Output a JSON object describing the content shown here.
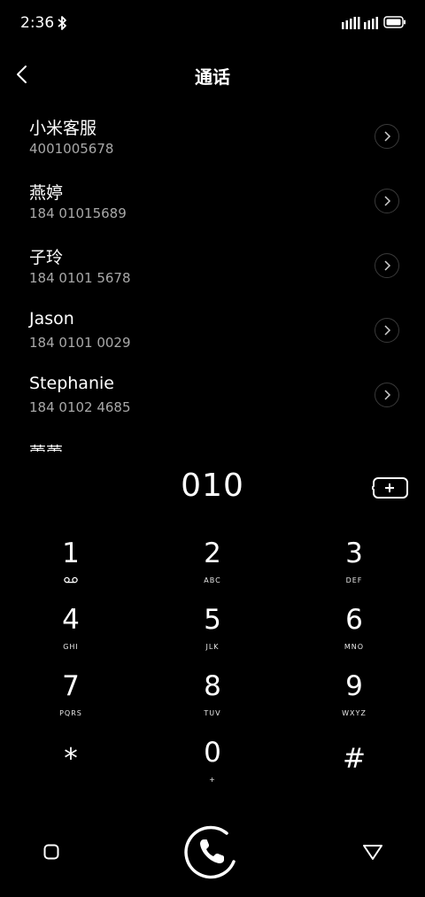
{
  "status_bar": {
    "time": "2:36",
    "icons": [
      "bluetooth-icon",
      "signal-icon",
      "signal-icon",
      "battery-icon"
    ]
  },
  "header": {
    "title": "通话",
    "back_icon": "chevron-left-icon"
  },
  "contacts": [
    {
      "name": "小米客服",
      "number": "4001005678"
    },
    {
      "name": "燕婷",
      "number": "184 01015689"
    },
    {
      "name": "子玲",
      "number": "184 0101 5678"
    },
    {
      "name": "Jason",
      "number": "184 0101 0029"
    },
    {
      "name": "Stephanie",
      "number": "184 0102 4685"
    },
    {
      "name": "蕾蕾",
      "number": ""
    }
  ],
  "dialer": {
    "input_value": "010",
    "add_contact_icon": "add-contact-icon"
  },
  "keypad": [
    {
      "digit": "1",
      "letters": "",
      "icon": "voicemail-icon"
    },
    {
      "digit": "2",
      "letters": "ABC"
    },
    {
      "digit": "3",
      "letters": "DEF"
    },
    {
      "digit": "4",
      "letters": "GHI"
    },
    {
      "digit": "5",
      "letters": "JLK"
    },
    {
      "digit": "6",
      "letters": "MNO"
    },
    {
      "digit": "7",
      "letters": "PQRS"
    },
    {
      "digit": "8",
      "letters": "TUV"
    },
    {
      "digit": "9",
      "letters": "WXYZ"
    },
    {
      "digit": "*",
      "letters": ""
    },
    {
      "digit": "0",
      "letters": "+"
    },
    {
      "digit": "#",
      "letters": ""
    }
  ],
  "bottom_bar": {
    "icons": [
      "square-icon",
      "phone-call-icon",
      "triangle-down-icon"
    ]
  },
  "colors": {
    "background": "#000000",
    "primary_text": "#ffffff",
    "secondary_text": "#a8a8a8"
  }
}
